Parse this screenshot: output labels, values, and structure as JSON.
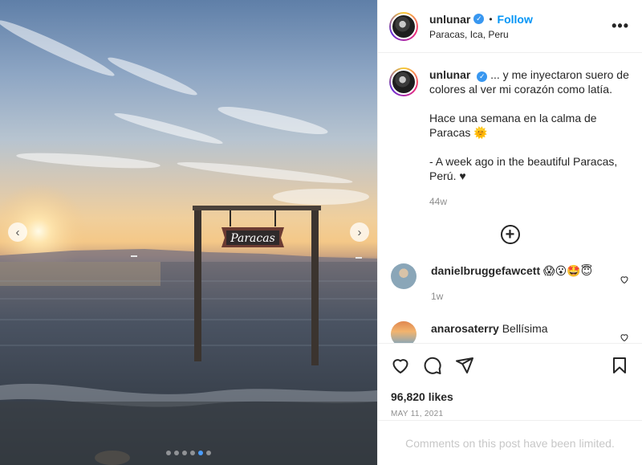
{
  "header": {
    "username": "unlunar",
    "separator": "•",
    "follow_label": "Follow",
    "location": "Paracas, Ica, Peru",
    "more_label": "•••"
  },
  "photo": {
    "sign_text": "Paracas",
    "slide_count": 6,
    "active_slide": 5
  },
  "caption": {
    "username": "unlunar",
    "line1": "... y me inyectaron suero de colores al ver mi corazón como latía.",
    "line2": "Hace una semana en la calma de Paracas 🌞",
    "line3": "- A week ago in the beautiful Paracas, Perú. ♥",
    "age": "44w"
  },
  "comments": [
    {
      "username": "danielbruggefawcett",
      "text": "😱😮🤩😇",
      "age": "1w"
    },
    {
      "username": "anarosaterry",
      "text": "Bellísima",
      "age": ""
    }
  ],
  "likes": "96,820 likes",
  "date": "MAY 11, 2021",
  "limited": "Comments on this post have been limited.",
  "colors": {
    "accent": "#0095f6",
    "verified": "#3897f0"
  }
}
